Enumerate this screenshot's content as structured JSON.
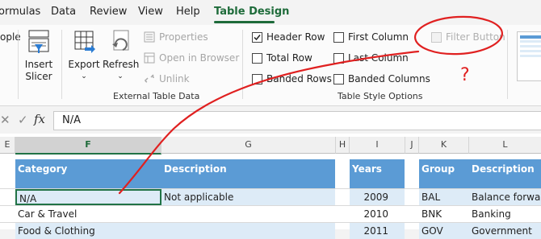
{
  "tabs": [
    {
      "label": "ormulas"
    },
    {
      "label": "Data"
    },
    {
      "label": "Review"
    },
    {
      "label": "View"
    },
    {
      "label": "Help"
    },
    {
      "label": "Table Design"
    }
  ],
  "tools": {
    "partial_label": "ople",
    "insert_slicer": "Insert\nSlicer",
    "insert_slicer_l1": "Insert",
    "insert_slicer_l2": "Slicer",
    "export": "Export",
    "refresh": "Refresh",
    "properties": "Properties",
    "open_in_browser": "Open in Browser",
    "unlink": "Unlink",
    "group_label": "External Table Data"
  },
  "style_options": {
    "header_row": {
      "label": "Header Row",
      "checked": true
    },
    "total_row": {
      "label": "Total Row",
      "checked": false
    },
    "banded_rows": {
      "label": "Banded Rows",
      "checked": false
    },
    "first_column": {
      "label": "First Column",
      "checked": false
    },
    "last_column": {
      "label": "Last Column",
      "checked": false
    },
    "banded_columns": {
      "label": "Banded Columns",
      "checked": false
    },
    "filter_button": {
      "label": "Filter Button",
      "checked": false,
      "disabled": true
    },
    "group_label": "Table Style Options"
  },
  "annotation": {
    "text": "?",
    "color": "#e02020"
  },
  "formula_bar": {
    "fx": "fx",
    "value": "N/A"
  },
  "columns": [
    "E",
    "F",
    "G",
    "H",
    "I",
    "J",
    "K",
    "L"
  ],
  "table1": {
    "headers": [
      "Category",
      "Description"
    ],
    "rows": [
      [
        "N/A",
        "Not applicable"
      ],
      [
        "Car & Travel",
        ""
      ],
      [
        "Food & Clothing",
        ""
      ]
    ]
  },
  "table2": {
    "header": "Years",
    "values": [
      "2009",
      "2010",
      "2011"
    ]
  },
  "table3": {
    "headers": [
      "Group",
      "Description"
    ],
    "rows": [
      [
        "BAL",
        "Balance forward"
      ],
      [
        "BNK",
        "Banking"
      ],
      [
        "GOV",
        "Government"
      ]
    ]
  },
  "colors": {
    "accent": "#1e6b3a",
    "table_header": "#5b9bd5",
    "band": "#ddebf7"
  }
}
